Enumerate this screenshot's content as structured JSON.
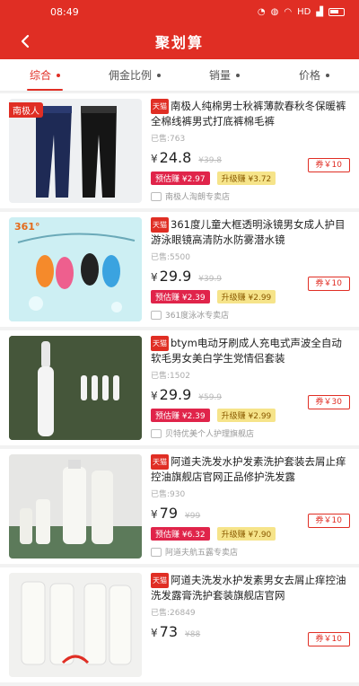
{
  "status_bar": {
    "time": "08:49",
    "signal_text": "HD"
  },
  "header": {
    "title": "聚划算",
    "back_icon": "back-arrow-icon"
  },
  "sort": [
    {
      "label": "综合",
      "active": true
    },
    {
      "label": "佣金比例",
      "active": false
    },
    {
      "label": "销量",
      "active": false
    },
    {
      "label": "价格",
      "active": false
    }
  ],
  "products": [
    {
      "platform": "天猫",
      "title": "南极人纯棉男士秋裤薄款春秋冬保暖裤全棉线裤男式打底裤棉毛裤",
      "sold": "已售:763",
      "currency": "¥",
      "price": "24.8",
      "orig": "¥39.8",
      "coupon": "券￥10",
      "badge_a": "预估赚 ¥2.97",
      "badge_b": "升级赚 ¥3.72",
      "shop": "南极人淘朗专卖店",
      "img_tag": "南极人"
    },
    {
      "platform": "天猫",
      "title": "361度儿童大框透明泳镜男女成人护目游泳眼镜高清防水防雾潜水镜",
      "sold": "已售:5500",
      "currency": "¥",
      "price": "29.9",
      "orig": "¥39.9",
      "coupon": "券￥10",
      "badge_a": "预估赚 ¥2.39",
      "badge_b": "升级赚 ¥2.99",
      "shop": "361度泳冰专卖店",
      "img_tag": "361°"
    },
    {
      "platform": "天猫",
      "title": "btym电动牙刷成人充电式声波全自动软毛男女美白学生党情侣套装",
      "sold": "已售:1502",
      "currency": "¥",
      "price": "29.9",
      "orig": "¥59.9",
      "coupon": "券￥30",
      "badge_a": "预估赚 ¥2.39",
      "badge_b": "升级赚 ¥2.99",
      "shop": "贝特优美个人护理旗舰店",
      "img_tag": ""
    },
    {
      "platform": "天猫",
      "title": "阿道夫洗发水护发素洗护套装去屑止痒控油旗舰店官网正品修护洗发露",
      "sold": "已售:930",
      "currency": "¥",
      "price": "79",
      "orig": "¥99",
      "coupon": "券￥10",
      "badge_a": "预估赚 ¥6.32",
      "badge_b": "升级赚 ¥7.90",
      "shop": "阿道夫航五露专卖店",
      "img_tag": ""
    },
    {
      "platform": "天猫",
      "title": "阿道夫洗发水护发素男女去屑止痒控油洗发露膏洗护套装旗舰店官网",
      "sold": "已售:26849",
      "currency": "¥",
      "price": "73",
      "orig": "¥88",
      "coupon": "券￥10",
      "badge_a": "",
      "badge_b": "",
      "shop": "",
      "img_tag": ""
    }
  ]
}
